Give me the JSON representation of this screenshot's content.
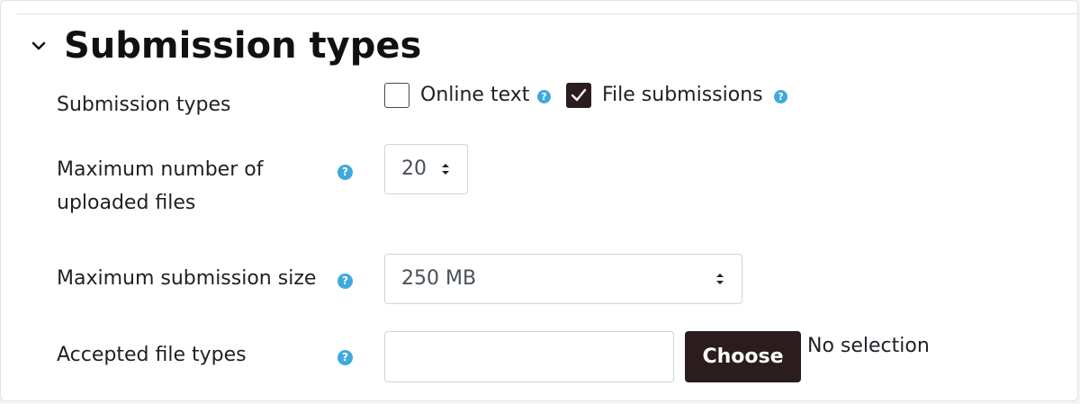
{
  "section": {
    "title": "Submission types",
    "collapse_icon": "chevron-down-icon"
  },
  "fields": {
    "submission_types": {
      "label": "Submission types",
      "options": [
        {
          "label": "Online text",
          "checked": false
        },
        {
          "label": "File submissions",
          "checked": true
        }
      ]
    },
    "max_files": {
      "label_line1": "Maximum number of",
      "label_line2": "uploaded files",
      "value": "20"
    },
    "max_size": {
      "label": "Maximum submission size",
      "value": "250 MB"
    },
    "file_types": {
      "label": "Accepted file types",
      "value": "",
      "button_label": "Choose",
      "status": "No selection"
    }
  },
  "help_icon_glyph": "?",
  "colors": {
    "help_icon": "#3fa9dd",
    "primary_button": "#2b1d1d",
    "checked_box": "#2b1d1d"
  }
}
